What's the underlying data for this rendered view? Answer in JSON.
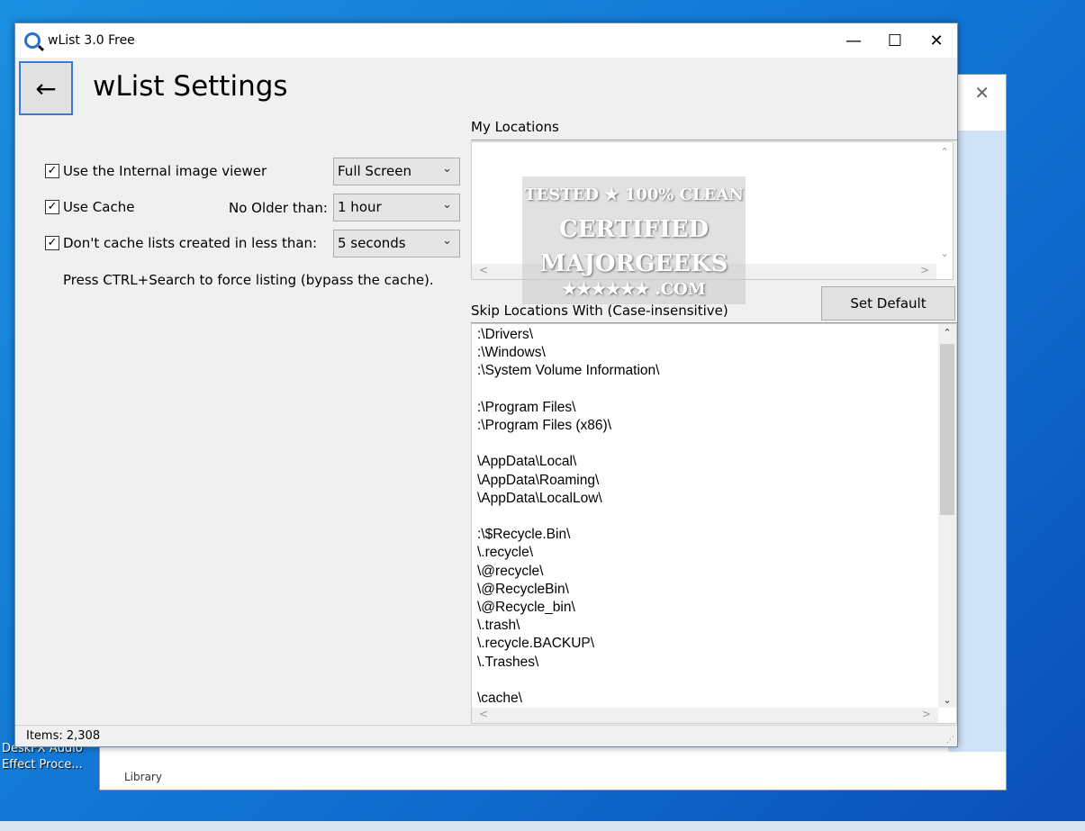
{
  "window": {
    "title": "wList 3.0 Free",
    "minimize": "—",
    "maximize": "☐",
    "close": "✕"
  },
  "header": {
    "back": "←",
    "title": "wList Settings"
  },
  "options": {
    "image_viewer": {
      "label": "Use the Internal image viewer",
      "checked": true,
      "value": "Full Screen"
    },
    "cache": {
      "label": "Use Cache",
      "checked": true,
      "older_label": "No Older than:",
      "value": "1 hour"
    },
    "dont_cache": {
      "label": "Don't cache lists created in less than:",
      "checked": true,
      "value": "5 seconds"
    },
    "hint": "Press CTRL+Search to force listing (bypass the cache)."
  },
  "my_locations": {
    "label": "My Locations",
    "items": []
  },
  "watermark": {
    "line1": "TESTED ★ 100% CLEAN",
    "line2": "CERTIFIED",
    "line3": "MAJORGEEKS",
    "line4": "★★★★★★ .COM"
  },
  "set_default": "Set Default",
  "skip_locations": {
    "label": "Skip Locations With (Case-insensitive)",
    "text": ":\\Drivers\\\n:\\Windows\\\n:\\System Volume Information\\\n\n:\\Program Files\\\n:\\Program Files (x86)\\\n\n\\AppData\\Local\\\n\\AppData\\Roaming\\\n\\AppData\\LocalLow\\\n\n:\\$Recycle.Bin\\\n\\.recycle\\\n\\@recycle\\\n\\@RecycleBin\\\n\\@Recycle_bin\\\n\\.trash\\\n\\.recycle.BACKUP\\\n\\.Trashes\\\n\n\\cache\\"
  },
  "status": {
    "items": "Items: 2,308"
  },
  "desktop": {
    "icon_label": "DeskFX Audio Effect Proce...",
    "library": "Library"
  }
}
